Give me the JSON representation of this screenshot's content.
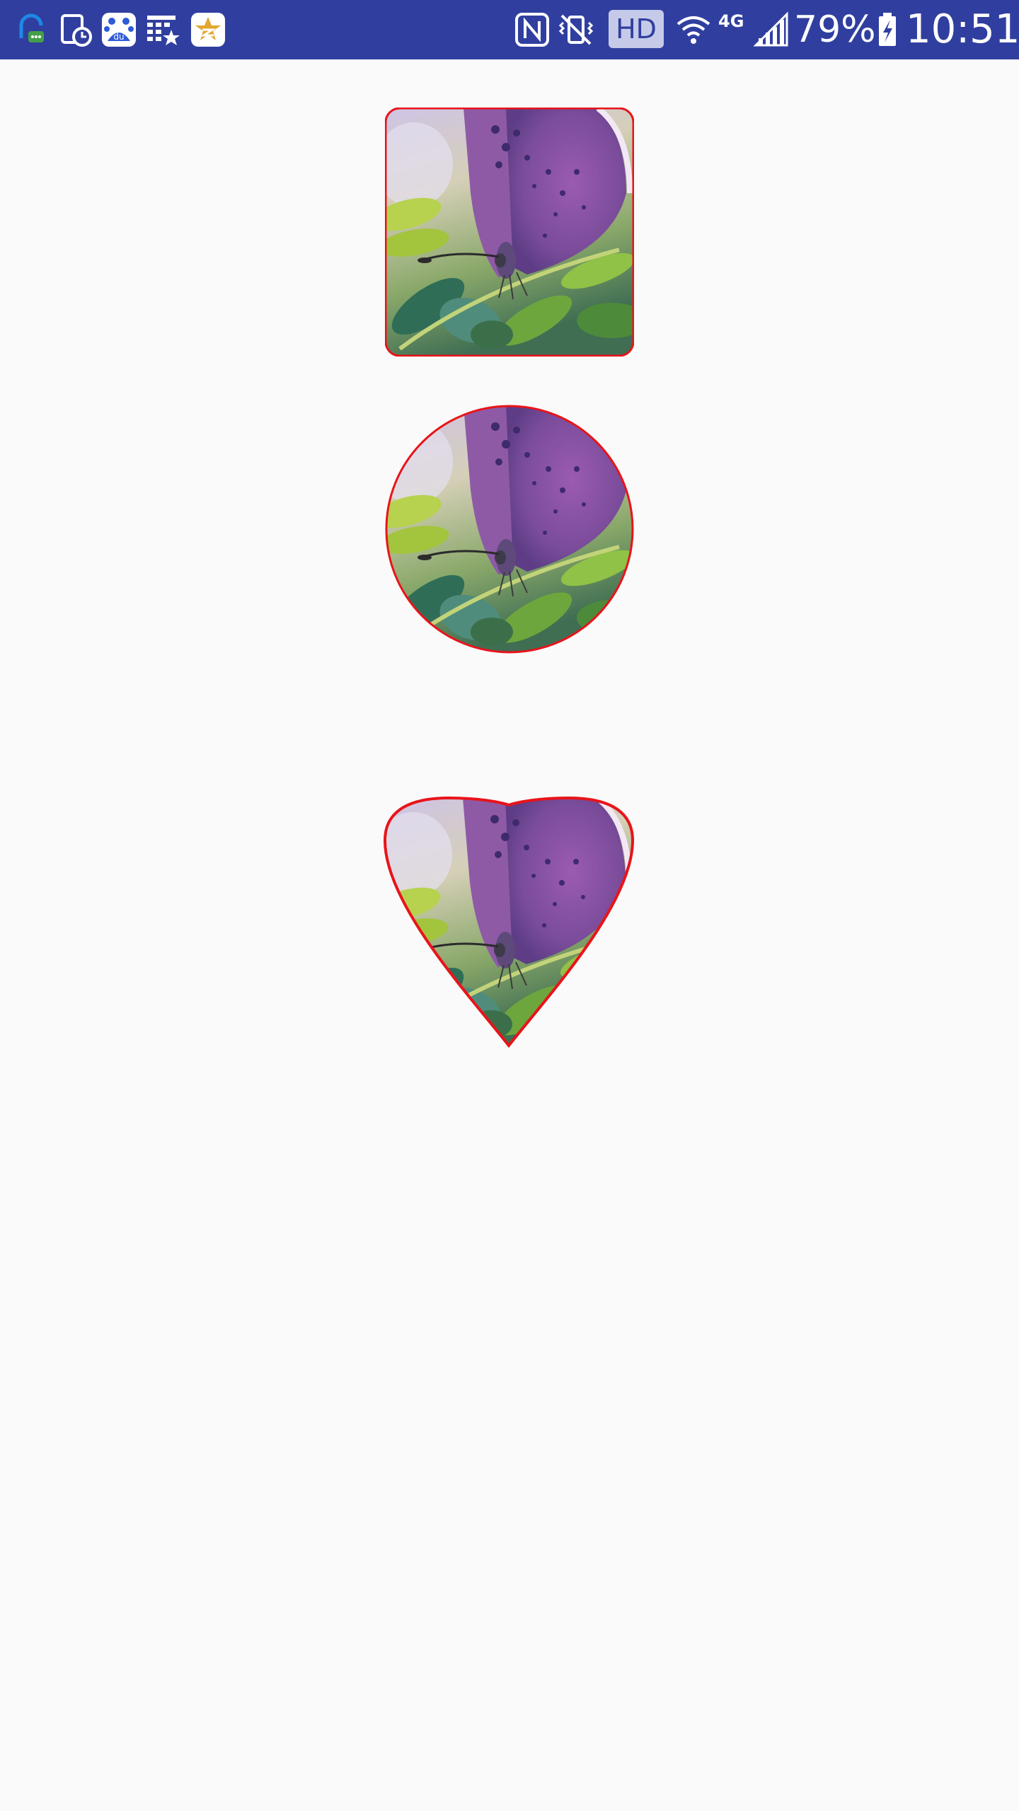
{
  "status_bar": {
    "background": "#303f9f",
    "notification_icons": [
      "notification-assistant-icon",
      "screen-timer-icon",
      "baidu-paw-icon",
      "calendar-star-icon",
      "star-badge-icon"
    ],
    "system_icons": [
      "nfc-icon",
      "vibrate-icon",
      "hd-voice-icon",
      "wifi-icon",
      "signal-icon",
      "battery-charging-icon"
    ],
    "hd_label": "HD",
    "network_label": "4G",
    "battery_percent": "79%",
    "time": "10:51"
  },
  "images": [
    {
      "shape": "rounded-square",
      "subject": "butterfly photo",
      "border_color": "#e8141a"
    },
    {
      "shape": "circle",
      "subject": "butterfly photo",
      "border_color": "#e8141a"
    },
    {
      "shape": "heart-drop",
      "subject": "butterfly photo",
      "border_color": "#e8141a"
    }
  ]
}
